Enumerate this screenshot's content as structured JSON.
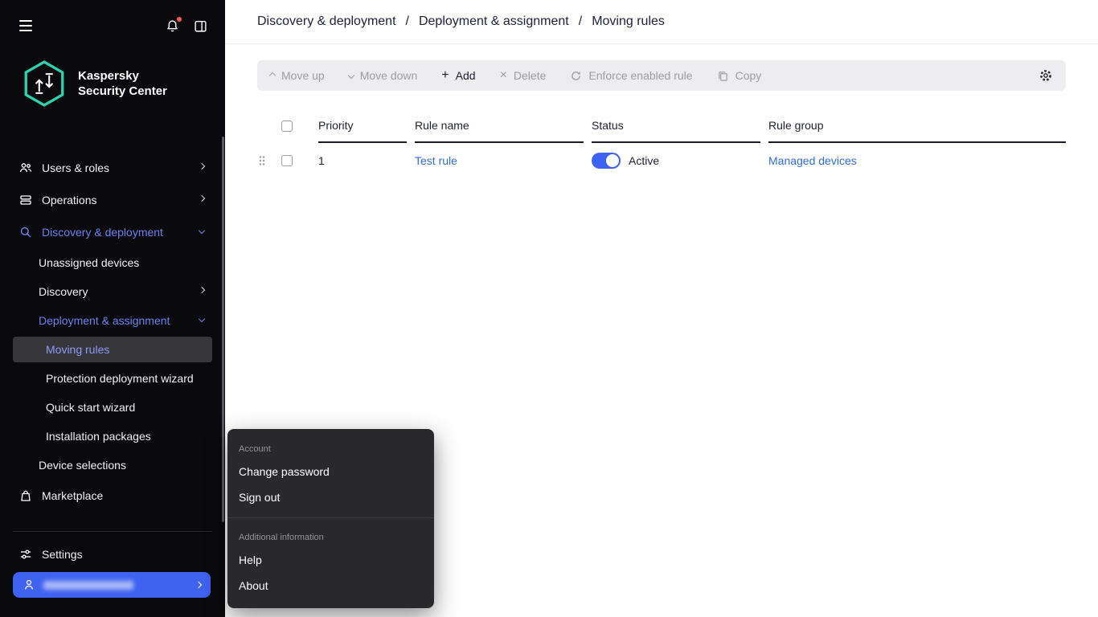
{
  "colors": {
    "accent": "#3F62F0",
    "logo_teal": "#2BD4AE",
    "link": "#2E6BE0",
    "sidebar_bg": "#0A0A0C"
  },
  "sidebar": {
    "logo_line1": "Kaspersky",
    "logo_line2": "Security Center",
    "items": {
      "users": "Users & roles",
      "operations": "Operations",
      "discovery_deployment": "Discovery & deployment",
      "unassigned_devices": "Unassigned devices",
      "discovery": "Discovery",
      "deployment_assignment": "Deployment & assignment",
      "moving_rules": "Moving rules",
      "protection_wizard": "Protection deployment wizard",
      "quick_start": "Quick start wizard",
      "installation_packages": "Installation packages",
      "device_selections": "Device selections",
      "marketplace": "Marketplace",
      "settings": "Settings"
    }
  },
  "breadcrumb": {
    "items": [
      "Discovery & deployment",
      "Deployment & assignment",
      "Moving rules"
    ],
    "separator": "/"
  },
  "toolbar": {
    "move_up": "Move up",
    "move_down": "Move down",
    "add": "Add",
    "delete": "Delete",
    "enforce": "Enforce enabled rule",
    "copy": "Copy",
    "icons": {
      "add": "+",
      "delete": "×"
    }
  },
  "table": {
    "headers": {
      "priority": "Priority",
      "rule_name": "Rule name",
      "status": "Status",
      "rule_group": "Rule group"
    },
    "rows": [
      {
        "priority": "1",
        "rule_name": "Test rule",
        "status_label": "Active",
        "rule_group": "Managed devices"
      }
    ]
  },
  "menu": {
    "account_header": "Account",
    "change_password": "Change password",
    "sign_out": "Sign out",
    "additional_header": "Additional information",
    "help": "Help",
    "about": "About"
  }
}
